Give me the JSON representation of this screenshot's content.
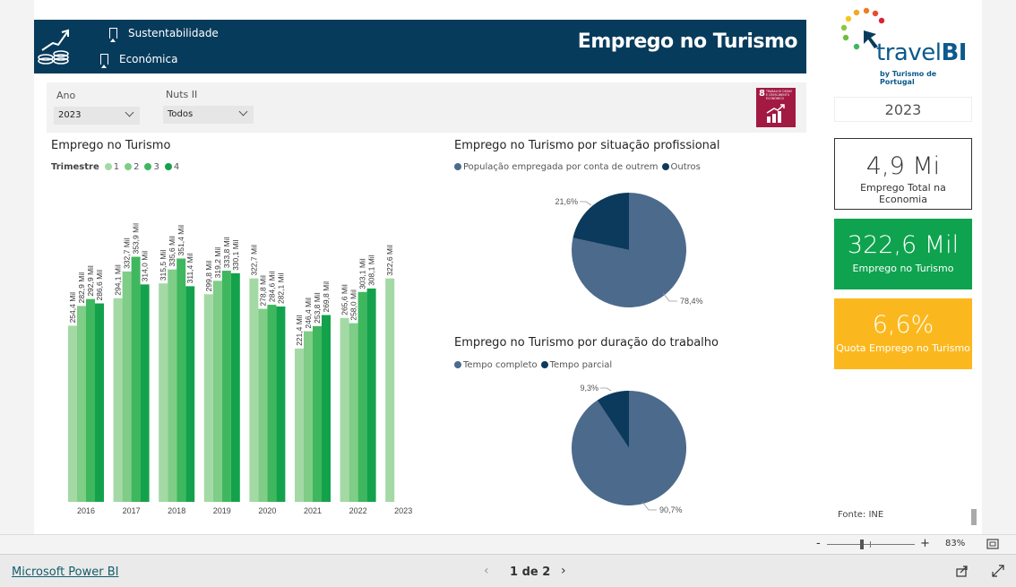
{
  "header": {
    "title": "Emprego no Turismo",
    "nav_sustentabilidade": "Sustentabilidade",
    "nav_economica": "Económica"
  },
  "filters": {
    "ano_label": "Ano",
    "ano_value": "2023",
    "nuts_label": "Nuts II",
    "nuts_value": "Todos"
  },
  "sdg_badge": {
    "number": "8",
    "text": "TRABALHO DIGNO E CRESCIMENTO ECONÓMICO"
  },
  "logo": {
    "brand": "travelBI",
    "brand_a": "travel",
    "brand_b": "BI",
    "tagline": "by Turismo de Portugal"
  },
  "year_display": "2023",
  "kpis": {
    "total_economy": {
      "value": "4,9 Mi",
      "label": "Emprego Total na Economia"
    },
    "tourism": {
      "value": "322,6 Mil",
      "label": "Emprego no Turismo",
      "color": "#0fa34f"
    },
    "quota": {
      "value": "6,6%",
      "label": "Quota Emprego no Turismo",
      "color": "#fbb81e"
    }
  },
  "source": "Fonte: INE",
  "colors": {
    "header_bg": "#073b5c",
    "q1": "#a3d9a5",
    "q2": "#7fcd87",
    "q3": "#3fb75f",
    "q4": "#13a24b",
    "pie_main": "#4c6a8c",
    "pie_other": "#0c3a5c"
  },
  "chart_data": [
    {
      "type": "bar",
      "title": "Emprego no Turismo",
      "legend_title": "Trimestre",
      "categories": [
        "2016",
        "2017",
        "2018",
        "2019",
        "2020",
        "2021",
        "2022",
        "2023"
      ],
      "series": [
        {
          "name": "1",
          "values": [
            254.4,
            294.1,
            315.5,
            299.8,
            322.7,
            221.4,
            265.6,
            322.6
          ],
          "labels": [
            "254,4 Mil",
            "294,1 Mil",
            "315,5 Mil",
            "299,8 Mil",
            "322,7 Mil",
            "221,4 Mil",
            "265,6 Mil",
            "322,6 Mil"
          ]
        },
        {
          "name": "2",
          "values": [
            282.9,
            332.7,
            335.6,
            319.2,
            278.8,
            246.4,
            258.0,
            null
          ],
          "labels": [
            "282,9 Mil",
            "332,7 Mil",
            "335,6 Mil",
            "319,2 Mil",
            "278,8 Mil",
            "246,4 Mil",
            "258,0 Mil",
            ""
          ]
        },
        {
          "name": "3",
          "values": [
            292.9,
            353.9,
            351.4,
            333.8,
            284.6,
            253.8,
            303.1,
            null
          ],
          "labels": [
            "292,9 Mil",
            "353,9 Mil",
            "351,4 Mil",
            "333,8 Mil",
            "284,6 Mil",
            "253,8 Mil",
            "303,1 Mil",
            ""
          ]
        },
        {
          "name": "4",
          "values": [
            286.6,
            314.0,
            311.4,
            330.1,
            282.1,
            269.8,
            308.1,
            null
          ],
          "labels": [
            "286,6 Mil",
            "314,0 Mil",
            "311,4 Mil",
            "330,1 Mil",
            "282,1 Mil",
            "269,8 Mil",
            "308,1 Mil",
            ""
          ]
        }
      ],
      "ylim": [
        0,
        440
      ]
    },
    {
      "type": "pie",
      "title": "Emprego no Turismo por situação profissional",
      "slices": [
        {
          "name": "População empregada por conta de outrem",
          "value": 78.4,
          "label": "78,4%"
        },
        {
          "name": "Outros",
          "value": 21.6,
          "label": "21,6%"
        }
      ]
    },
    {
      "type": "pie",
      "title": "Emprego no Turismo por duração do trabalho",
      "slices": [
        {
          "name": "Tempo completo",
          "value": 90.7,
          "label": "90,7%"
        },
        {
          "name": "Tempo parcial",
          "value": 9.3,
          "label": "9,3%"
        }
      ]
    }
  ],
  "statusbar": {
    "zoom_minus": "-",
    "zoom_plus": "+",
    "zoom_level": "83%",
    "powerbi_link": "Microsoft Power BI",
    "page_indicator": "1 de 2"
  }
}
